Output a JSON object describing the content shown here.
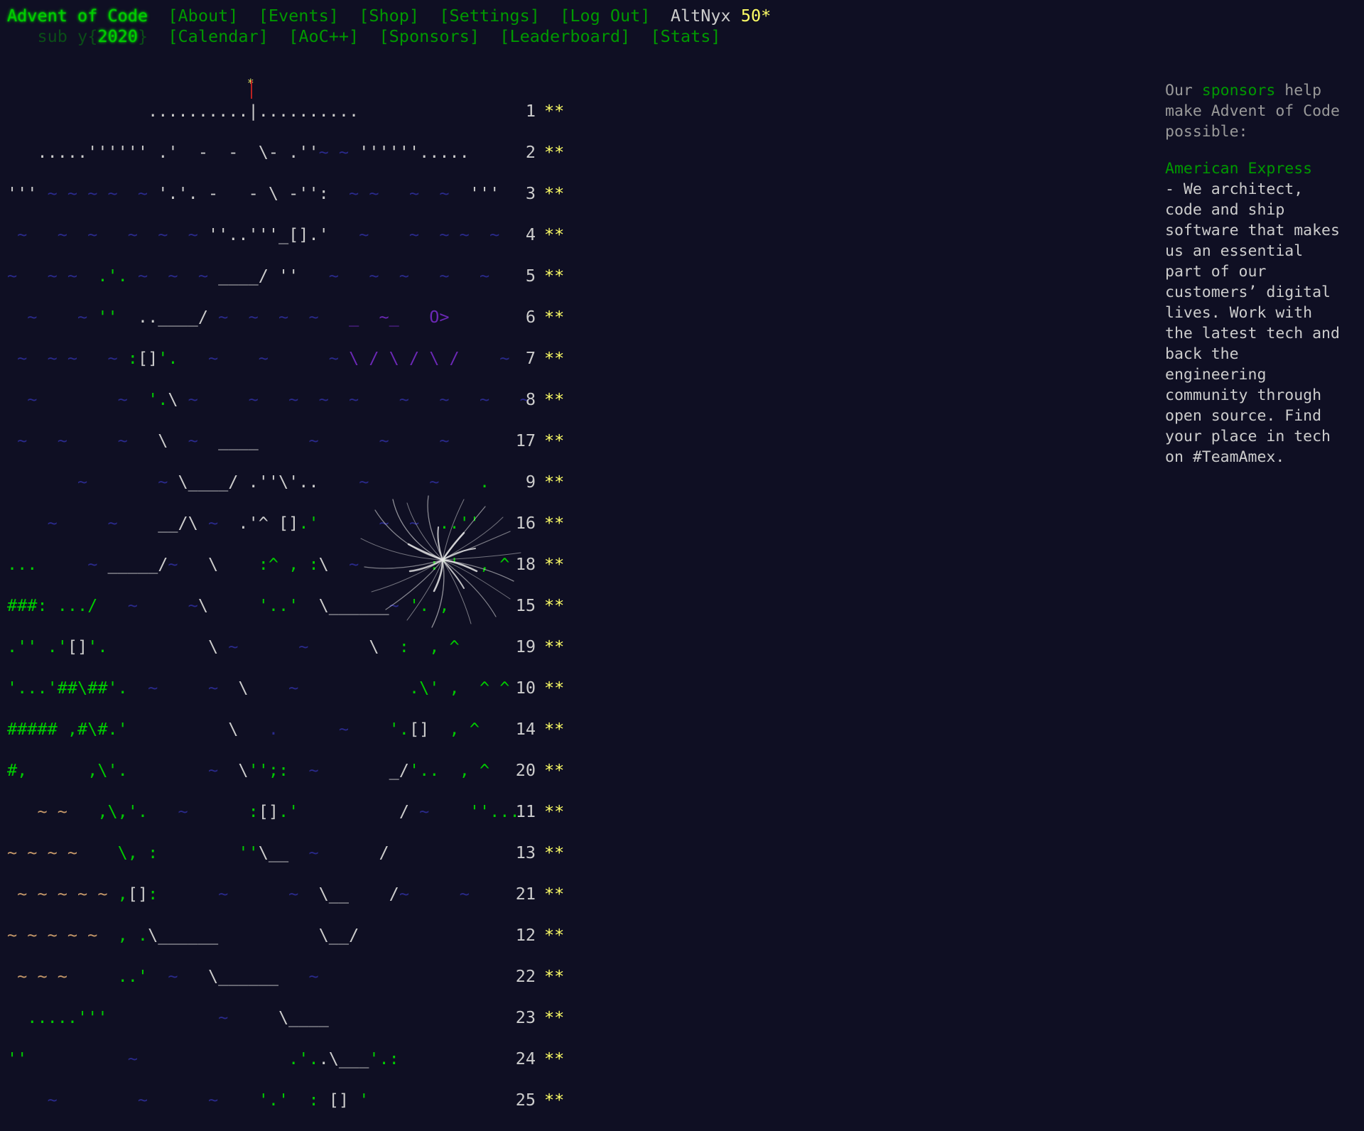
{
  "header": {
    "title": "Advent of Code",
    "nav_top": [
      "[About]",
      "[Events]",
      "[Shop]",
      "[Settings]",
      "[Log Out]"
    ],
    "user": "AltNyx",
    "star_count": "50*",
    "year_prefix": "sub y{",
    "year": "2020",
    "year_suffix": "}",
    "nav_bottom": [
      "[Calendar]",
      "[AoC++]",
      "[Sponsors]",
      "[Leaderboard]",
      "[Stats]"
    ]
  },
  "calendar": {
    "rows": [
      {
        "day": "1",
        "stars": "**"
      },
      {
        "day": "2",
        "stars": "**"
      },
      {
        "day": "3",
        "stars": "**"
      },
      {
        "day": "4",
        "stars": "**"
      },
      {
        "day": "5",
        "stars": "**"
      },
      {
        "day": "6",
        "stars": "**"
      },
      {
        "day": "7",
        "stars": "**"
      },
      {
        "day": "8",
        "stars": "**"
      },
      {
        "day": "17",
        "stars": "**"
      },
      {
        "day": "9",
        "stars": "**"
      },
      {
        "day": "16",
        "stars": "**"
      },
      {
        "day": "18",
        "stars": "**"
      },
      {
        "day": "15",
        "stars": "**"
      },
      {
        "day": "19",
        "stars": "**"
      },
      {
        "day": "10",
        "stars": "**"
      },
      {
        "day": "14",
        "stars": "**"
      },
      {
        "day": "20",
        "stars": "**"
      },
      {
        "day": "11",
        "stars": "**"
      },
      {
        "day": "13",
        "stars": "**"
      },
      {
        "day": "21",
        "stars": "**"
      },
      {
        "day": "12",
        "stars": "**"
      },
      {
        "day": "22",
        "stars": "**"
      },
      {
        "day": "23",
        "stars": "**"
      },
      {
        "day": "24",
        "stars": "**"
      },
      {
        "day": "25",
        "stars": "**"
      }
    ]
  },
  "sidebar": {
    "intro_before": "Our ",
    "intro_link": "sponsors",
    "intro_after": " help make Advent of Code possible:",
    "sponsor_name": "American Express",
    "sponsor_desc": " - We architect, code and ship software that makes us an essential part of our customers’ digital lives. Work with the latest tech and back the engineering community through open source. Find your place in tech on #TeamAmex."
  },
  "colors": {
    "background": "#0f0f23",
    "text": "#cccccc",
    "title_green": "#00cc00",
    "link_green": "#009900",
    "star_yellow": "#ffff66",
    "water_blue": "#2a2a8c",
    "purple": "#6b28b5"
  }
}
